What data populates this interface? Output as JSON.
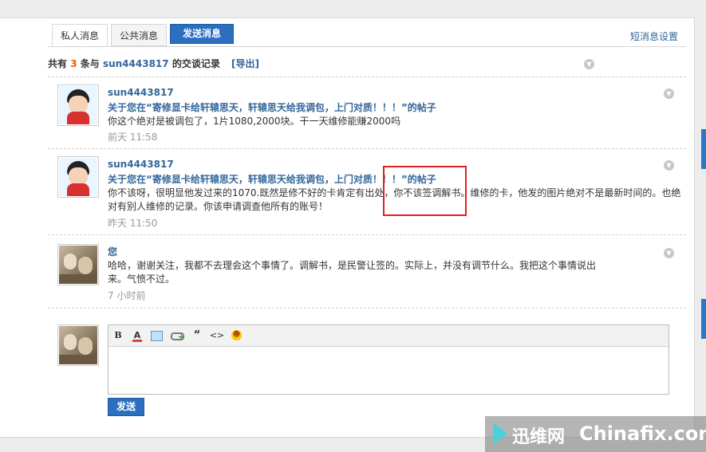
{
  "tabs": [
    {
      "label": "私人消息",
      "active": true
    },
    {
      "label": "公共消息",
      "active": false
    }
  ],
  "send_message_button": "发送消息",
  "settings_link": "短消息设置",
  "summary": {
    "prefix": "共有",
    "count": "3",
    "mid": "条与",
    "username": "sun4443817",
    "suffix": "的交谈记录",
    "export": "[导出]"
  },
  "messages": [
    {
      "author": "sun4443817",
      "avatar": "cartoon-boy",
      "subject": "关于您在“寄修显卡给轩辕思天，轩辕思天给我调包，上门对质！！！”的帖子",
      "body": "你这个绝对是被调包了，1片1080,2000块。干一天维修能赚2000吗",
      "time": "前天 11:58"
    },
    {
      "author": "sun4443817",
      "avatar": "cartoon-boy",
      "subject": "关于您在“寄修显卡给轩辕思天，轩辕思天给我调包，上门对质！！！”的帖子",
      "body": "你不该呀，很明显他发过来的1070.既然是修不好的卡肯定有出处，你不该签调解书。维修的卡，他发的图片绝对不是最新时间的。也绝对有别人维修的记录。你该申请调查他所有的账号！",
      "time": "昨天 11:50"
    },
    {
      "author": "您",
      "avatar": "cats-photo",
      "subject": "",
      "body": "哈哈，谢谢关注，我都不去理会这个事情了。调解书，是民警让签的。实际上，并没有调节什么。我把这个事情说出来。气愤不过。",
      "time": "7 小时前"
    }
  ],
  "editor": {
    "toolbar": [
      "bold-icon",
      "font-color-icon",
      "image-icon",
      "link-icon",
      "quote-icon",
      "code-icon",
      "smiley-icon"
    ],
    "bold_glyph": "B",
    "color_glyph": "A",
    "quote_glyph": "“",
    "code_glyph": "<>",
    "smiley_glyph": "☻"
  },
  "send_button": "发送",
  "watermark": {
    "cn": "迅维网",
    "en": "Chinafix.com"
  },
  "colors": {
    "accent": "#2a6fc0",
    "link": "#336699",
    "count": "#e05a00",
    "highlight_box": "#e02020"
  }
}
